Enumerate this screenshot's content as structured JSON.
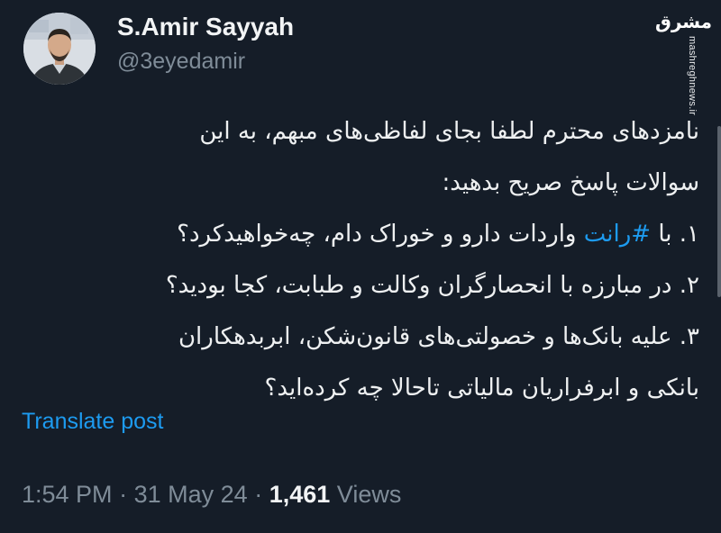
{
  "author": {
    "display_name": "S.Amir Sayyah",
    "handle": "@3eyedamir"
  },
  "watermark": {
    "logo_text": "مشرق",
    "url": "mashreghnews.ir"
  },
  "tweet": {
    "line1": "نامزدهای محترم لطفا بجای لفاظی‌های مبهم، به این",
    "line2": "سوالات پاسخ صریح بدهید:",
    "line3_before": "۱. با ",
    "hashtag": "#رانت",
    "line3_after": " واردات دارو و خوراک دام، چه‌خواهیدکرد؟",
    "line4": "۲. در مبارزه با انحصارگران وکالت و طبابت، کجا بودید؟",
    "line5": "۳. علیه بانک‌ها و خصولتی‌های قانون‌شکن، ابربدهکاران",
    "line6": "بانکی و ابرفراریان مالیاتی تاحالا چه کرده‌اید؟"
  },
  "translate_label": "Translate post",
  "meta": {
    "time": "1:54 PM",
    "separator": "·",
    "date": "31 May 24",
    "views_count": "1,461",
    "views_label": "Views"
  },
  "colors": {
    "background": "#151d28",
    "text": "#eef0f1",
    "secondary": "#7f8c98",
    "link": "#1d9bf0"
  }
}
